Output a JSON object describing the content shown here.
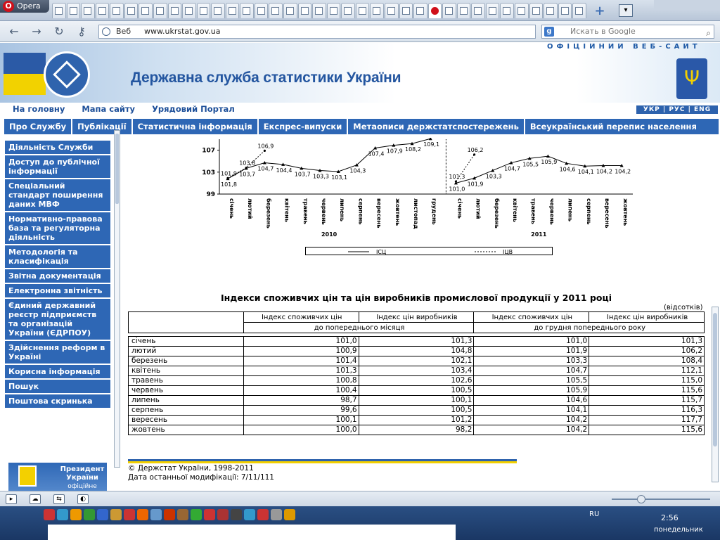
{
  "browser": {
    "app_name": "Opera",
    "address_label": "Веб",
    "url": "www.ukrstat.gov.ua",
    "search_placeholder": "Искать в Google",
    "tab_count": 37
  },
  "site": {
    "motto": "ОФІЦІЙНИЙ ВЕБ-САЙТ",
    "title": "Державна служба статистики України",
    "top_links": [
      "На головну",
      "Мапа сайту",
      "Урядовий Портал"
    ],
    "languages": "УКР | РУС | ENG",
    "main_menu": [
      "Про Службу",
      "Публікації",
      "Статистична інформація",
      "Експрес-випуски",
      "Метаописи держстатспостережень",
      "Всеукраїнський перепис населення"
    ],
    "sidebar": [
      "Діяльність Служби",
      "Доступ до публічної інформації",
      "Спеціальний стандарт поширення даних МВФ",
      "Нормативно-правова база та регуляторна діяльність",
      "Методологія та класифікація",
      "Звітна документація",
      "Електронна звітність",
      "Єдиний державний реєстр підприємств та організацій України (ЄДРПОУ)",
      "Здійснення реформ в Україні",
      "Корисна інформація",
      "Пошук",
      "Поштова скринька"
    ],
    "president_banner": "Президент України",
    "president_sub": "офіційне"
  },
  "chart_data": {
    "type": "line",
    "y_ticks": [
      "99",
      "103",
      "107"
    ],
    "ylim": [
      99,
      109
    ],
    "years": [
      "2010",
      "2011"
    ],
    "categories_2010": [
      "січень",
      "лютий",
      "березень",
      "квітень",
      "травень",
      "червень",
      "липень",
      "серпень",
      "вересень",
      "жовтень",
      "листопад",
      "грудень"
    ],
    "categories_2011": [
      "січень",
      "лютий",
      "березень",
      "квітень",
      "травень",
      "червень",
      "липень",
      "серпень",
      "вересень",
      "жовтень"
    ],
    "series": [
      {
        "name": "ІСЦ",
        "values_2010": [
          101.8,
          103.7,
          104.7,
          104.4,
          103.7,
          103.3,
          103.1,
          104.3,
          107.4,
          107.9,
          108.2,
          109.1
        ],
        "values_2011": [
          101.0,
          101.9,
          103.3,
          104.7,
          105.5,
          105.9,
          104.6,
          104.1,
          104.2,
          104.2
        ]
      },
      {
        "name": "ІЦВ",
        "values_2010": [
          101.9,
          103.8,
          106.9
        ],
        "values_2011": [
          101.3,
          106.2
        ]
      }
    ],
    "legend": [
      "ІСЦ",
      "ІЦВ"
    ]
  },
  "table": {
    "title": "Індекси споживчих цін та цін виробників промислової продукції у 2011 році",
    "unit": "(відсотків)",
    "col_headers": [
      "Індекс споживчих цін",
      "Індекс цін виробників",
      "Індекс споживчих цін",
      "Індекс цін виробників"
    ],
    "group_headers": [
      "до попереднього місяця",
      "до грудня попереднього року"
    ],
    "rows": [
      {
        "month": "січень",
        "v": [
          "101,0",
          "101,3",
          "101,0",
          "101,3"
        ]
      },
      {
        "month": "лютий",
        "v": [
          "100,9",
          "104,8",
          "101,9",
          "106,2"
        ]
      },
      {
        "month": "березень",
        "v": [
          "101,4",
          "102,1",
          "103,3",
          "108,4"
        ]
      },
      {
        "month": "квітень",
        "v": [
          "101,3",
          "103,4",
          "104,7",
          "112,1"
        ]
      },
      {
        "month": "травень",
        "v": [
          "100,8",
          "102,6",
          "105,5",
          "115,0"
        ]
      },
      {
        "month": "червень",
        "v": [
          "100,4",
          "100,5",
          "105,9",
          "115,6"
        ]
      },
      {
        "month": "липень",
        "v": [
          "98,7",
          "100,1",
          "104,6",
          "115,7"
        ]
      },
      {
        "month": "серпень",
        "v": [
          "99,6",
          "100,5",
          "104,1",
          "116,3"
        ]
      },
      {
        "month": "вересень",
        "v": [
          "100,1",
          "101,2",
          "104,2",
          "117,7"
        ]
      },
      {
        "month": "жовтень",
        "v": [
          "100,0",
          "98,2",
          "104,2",
          "115,6"
        ]
      }
    ]
  },
  "footer": {
    "copyright": "© Держстат України, 1998-2011",
    "modified": "Дата останньої модифікації: 7/11/111"
  },
  "status": {
    "lang": "RU",
    "time": "2:56",
    "day": "понедельник"
  },
  "colors": {
    "brand": "#2e67b5",
    "title": "#2456a0"
  }
}
